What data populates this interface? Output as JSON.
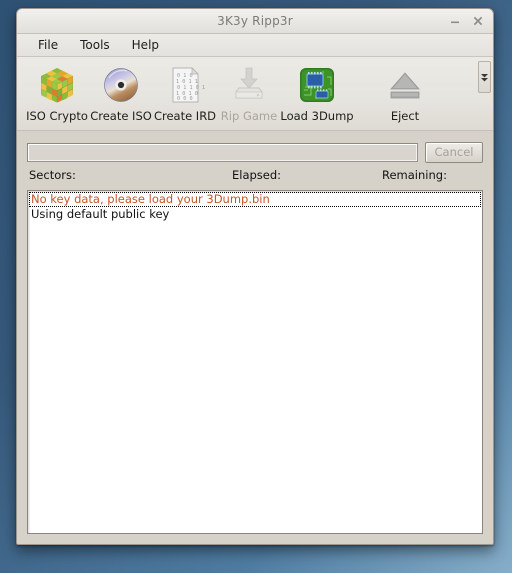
{
  "window": {
    "title": "3K3y Ripp3r",
    "controls": [
      {
        "name": "minimize",
        "glyph": "minimize-icon"
      },
      {
        "name": "close",
        "glyph": "close-icon"
      }
    ]
  },
  "menubar": {
    "items": [
      {
        "label": "File"
      },
      {
        "label": "Tools"
      },
      {
        "label": "Help"
      }
    ]
  },
  "toolbar": {
    "overflow_icon": "chevron-double-down-icon",
    "items": [
      {
        "label": "ISO Crypto",
        "icon": "rubiks-cube-icon",
        "enabled": true
      },
      {
        "label": "Create ISO",
        "icon": "optical-disc-icon",
        "enabled": true
      },
      {
        "label": "Create IRD",
        "icon": "binary-document-icon",
        "enabled": true
      },
      {
        "label": "Rip Game",
        "icon": "drive-download-icon",
        "enabled": false
      },
      {
        "label": "Load 3Dump",
        "icon": "circuit-board-icon",
        "enabled": true
      },
      {
        "label": "Eject",
        "icon": "eject-icon",
        "enabled": false
      }
    ]
  },
  "progress": {
    "value": 0,
    "cancel_label": "Cancel",
    "cancel_enabled": false
  },
  "status": {
    "sectors_label": "Sectors:",
    "sectors_value": "",
    "elapsed_label": "Elapsed:",
    "elapsed_value": "",
    "remaining_label": "Remaining:",
    "remaining_value": ""
  },
  "log": {
    "rows": [
      {
        "text": "No key data, please load your 3Dump.bin",
        "color": "#c4562a",
        "focused": true
      },
      {
        "text": "Using default public key",
        "color": "#111111",
        "focused": false
      }
    ]
  },
  "colors": {
    "desktop": "#36597b",
    "window_face": "#d6d2ca",
    "warning_text": "#c4562a",
    "disabled_text": "#a9a49d"
  }
}
